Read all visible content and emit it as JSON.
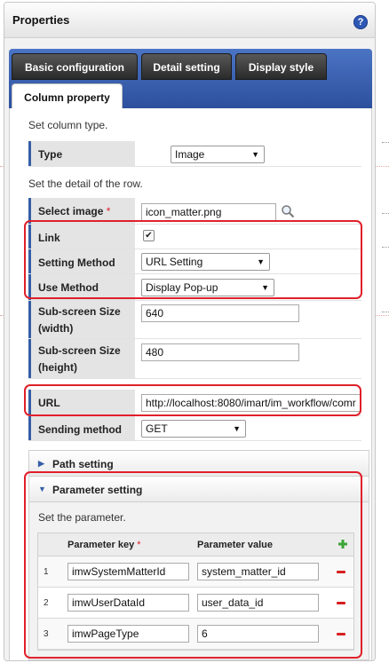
{
  "panel": {
    "title": "Properties",
    "help_icon": "?"
  },
  "tabs": [
    {
      "label": "Basic configuration",
      "active": false
    },
    {
      "label": "Detail setting",
      "active": false
    },
    {
      "label": "Display style",
      "active": false
    },
    {
      "label": "Column property",
      "active": true
    }
  ],
  "column_type": {
    "hint": "Set column type.",
    "type_label": "Type",
    "type_value": "Image"
  },
  "row_detail": {
    "hint": "Set the detail of the row.",
    "select_image": {
      "label": "Select image",
      "required_mark": "*",
      "value": "icon_matter.png",
      "icon": "magnifier-icon"
    },
    "link": {
      "label": "Link",
      "checked": true
    },
    "setting_method": {
      "label": "Setting Method",
      "value": "URL Setting"
    },
    "use_method": {
      "label": "Use Method",
      "value": "Display Pop-up"
    },
    "sub_width": {
      "label_line1": "Sub-screen Size",
      "label_line2": "(width)",
      "value": "640"
    },
    "sub_height": {
      "label_line1": "Sub-screen Size",
      "label_line2": "(height)",
      "value": "480"
    },
    "url": {
      "label": "URL",
      "value": "http://localhost:8080/imart/im_workflow/comr"
    },
    "sending_method": {
      "label": "Sending method",
      "value": "GET"
    }
  },
  "path_setting": {
    "title": "Path setting",
    "expanded": false
  },
  "parameter_setting": {
    "title": "Parameter setting",
    "expanded": true,
    "hint": "Set the parameter.",
    "columns": {
      "key": "Parameter key",
      "required_mark": "*",
      "value": "Parameter value"
    },
    "add_icon": "plus-icon",
    "rows": [
      {
        "num": "1",
        "key": "imwSystemMatterId",
        "value": "system_matter_id"
      },
      {
        "num": "2",
        "key": "imwUserDataId",
        "value": "user_data_id"
      },
      {
        "num": "3",
        "key": "imwPageType",
        "value": "6"
      }
    ]
  },
  "colors": {
    "tab_bar": "#2a4d99",
    "label_accent": "#355ea6",
    "highlight_box": "#e0202a",
    "remove_icon": "#d62020",
    "add_icon": "#3aa535"
  }
}
